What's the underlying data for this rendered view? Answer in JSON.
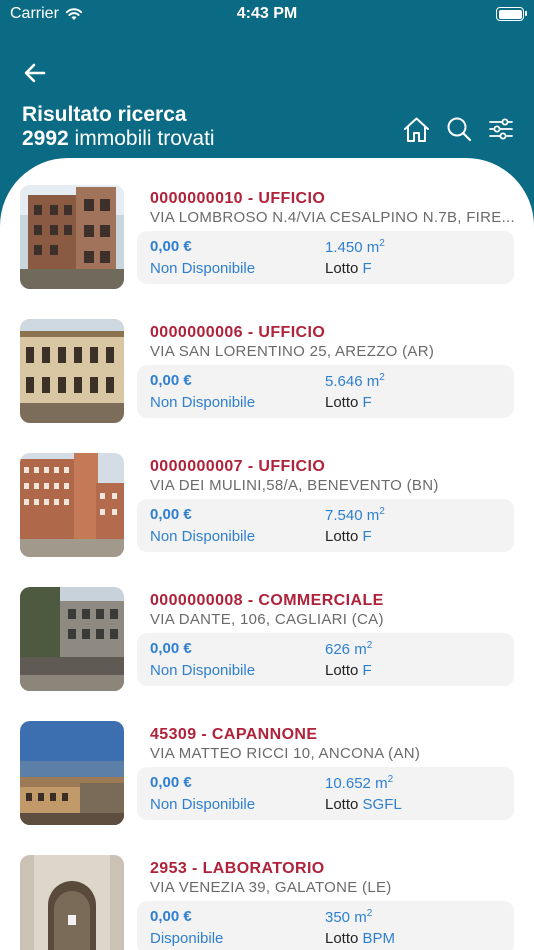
{
  "status_bar": {
    "carrier": "Carrier",
    "time": "4:43 PM"
  },
  "header": {
    "title": "Risultato ricerca",
    "count": "2992",
    "count_suffix": " immobili trovati"
  },
  "icons": {
    "back": "arrow-left-icon",
    "home": "home-icon",
    "search": "search-icon",
    "filters": "sliders-icon"
  },
  "colors": {
    "header_bg": "#0b6a84",
    "code": "#b0223a",
    "accent": "#2f7fd0"
  },
  "lotto_label": "Lotto",
  "area_unit": "m",
  "area_unit_sup": "2",
  "results": [
    {
      "code": "0000000010 - UFFICIO",
      "address": "VIA LOMBROSO N.4/VIA CESALPINO N.7B, FIRE...",
      "price": "0,00 €",
      "availability": "Non Disponibile",
      "area": "1.450",
      "lotto": "F"
    },
    {
      "code": "0000000006 - UFFICIO",
      "address": "VIA SAN LORENTINO 25, AREZZO (AR)",
      "price": "0,00 €",
      "availability": "Non Disponibile",
      "area": "5.646",
      "lotto": "F"
    },
    {
      "code": "0000000007 - UFFICIO",
      "address": "VIA DEI MULINI,58/A, BENEVENTO (BN)",
      "price": "0,00 €",
      "availability": "Non Disponibile",
      "area": "7.540",
      "lotto": "F"
    },
    {
      "code": "0000000008 - COMMERCIALE",
      "address": "VIA DANTE, 106, CAGLIARI (CA)",
      "price": "0,00 €",
      "availability": "Non Disponibile",
      "area": "626",
      "lotto": "F"
    },
    {
      "code": "45309 - CAPANNONE",
      "address": "VIA MATTEO RICCI 10, ANCONA (AN)",
      "price": "0,00 €",
      "availability": "Non Disponibile",
      "area": "10.652",
      "lotto": "SGFL"
    },
    {
      "code": "2953 - LABORATORIO",
      "address": "VIA VENEZIA 39, GALATONE (LE)",
      "price": "0,00 €",
      "availability": "Disponibile",
      "area": "350",
      "lotto": "BPM"
    }
  ]
}
